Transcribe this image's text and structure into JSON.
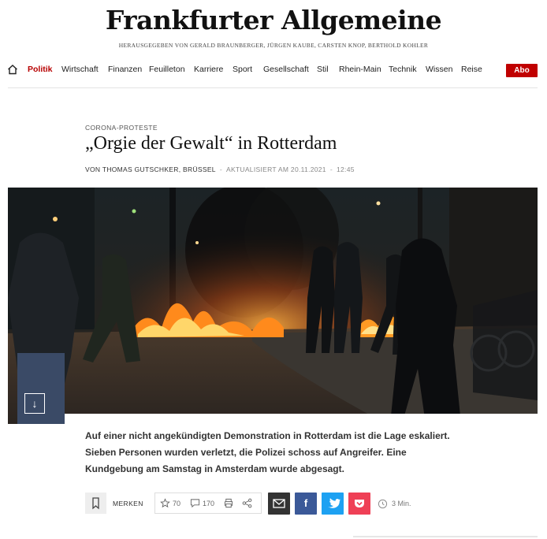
{
  "masthead": {
    "logo": "Frankfurter Allgemeine",
    "publishers": "HERAUSGEGEBEN VON GERALD BRAUNBERGER, JÜRGEN KAUBE, CARSTEN KNOP, BERTHOLD KOHLER"
  },
  "nav": {
    "items": [
      "Politik",
      "Wirtschaft",
      "Finanzen",
      "Feuilleton",
      "Karriere",
      "Sport",
      "Gesellschaft",
      "Stil",
      "Rhein-Main",
      "Technik",
      "Wissen",
      "Reise"
    ],
    "active": "Politik",
    "abo_label": "Abo",
    "home_icon": "home-icon"
  },
  "article": {
    "kicker": "CORONA-PROTESTE",
    "headline": "„Orgie der Gewalt“ in Rotterdam",
    "author": "VON THOMAS GUTSCHKER, BRÜSSEL",
    "updated": "AKTUALISIERT AM 20.11.2021",
    "time": "12:45",
    "teaser": "Auf einer nicht angekündigten Demonstration in Rotterdam ist die Lage eskaliert. Sieben Personen wurden verletzt, die Polizei schoss auf Angreifer. Eine Kundgebung am Samstag in Amsterdam wurde abgesagt."
  },
  "image": {
    "scroll_icon": "↓"
  },
  "toolbar": {
    "merken_label": "MERKEN",
    "star_count": "70",
    "comment_count": "170",
    "read_time": "3 Min."
  },
  "colors": {
    "brand_red": "#b70000",
    "abo_red": "#c00000",
    "mail": "#333333",
    "facebook": "#3b5998",
    "twitter": "#1da1f2",
    "pocket": "#ef4056"
  }
}
